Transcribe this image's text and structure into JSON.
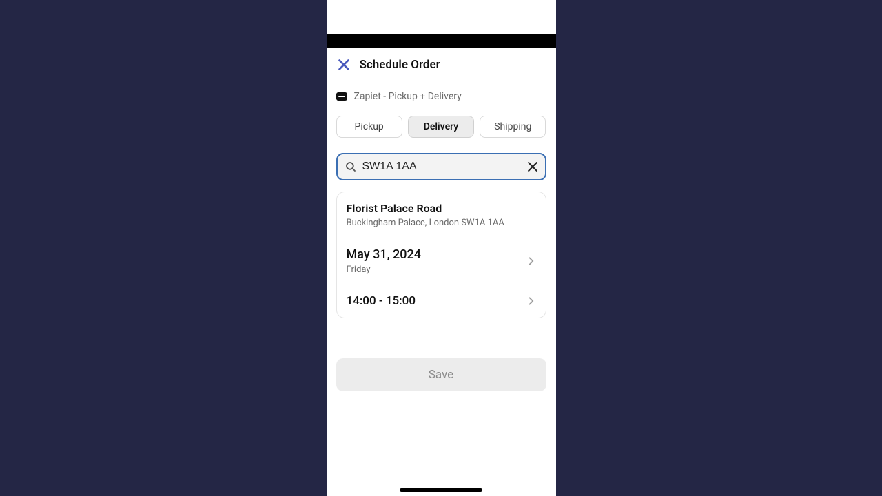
{
  "sheet": {
    "title": "Schedule Order",
    "provider": "Zapiet - Pickup + Delivery"
  },
  "tabs": {
    "pickup": "Pickup",
    "delivery": "Delivery",
    "shipping": "Shipping",
    "active": "delivery"
  },
  "search": {
    "value": "SW1A 1AA"
  },
  "location": {
    "name": "Florist Palace Road",
    "address": "Buckingham Palace, London SW1A 1AA"
  },
  "date": {
    "value": "May 31, 2024",
    "day": "Friday"
  },
  "time": {
    "value": "14:00 - 15:00"
  },
  "actions": {
    "save": "Save"
  }
}
